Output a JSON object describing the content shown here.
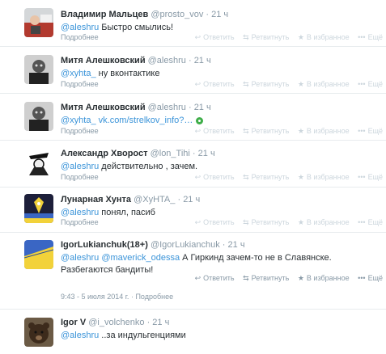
{
  "tweets": [
    {
      "fullname": "Владимир Мальцев",
      "username": "@prosto_vov",
      "time": "21 ч",
      "mention": "@aleshru",
      "text": " Быстро смылись!",
      "more": "Подробнее"
    },
    {
      "fullname": "Митя Алешковский",
      "username": "@aleshru",
      "time": "21 ч",
      "mention": "@xyhta_",
      "text": " ну вконтактике",
      "more": "Подробнее"
    },
    {
      "fullname": "Митя Алешковский",
      "username": "@aleshru",
      "time": "21 ч",
      "mention": "@xyhta_",
      "link": " vk.com/strelkov_info?…",
      "more": "Подробнее"
    },
    {
      "fullname": "Александр Хворост",
      "username": "@lon_Tihi",
      "time": "21 ч",
      "mention": "@aleshru",
      "text": " действительно , зачем.",
      "more": "Подробнее"
    },
    {
      "fullname": "Лунарная Хунта",
      "username": "@XyHTA_",
      "time": "21 ч",
      "mention": "@aleshru",
      "text": " понял, пасиб",
      "more": "Подробнее"
    },
    {
      "fullname": "IgorLukianchuk(18+)",
      "username": "@IgorLukianchuk",
      "time": "21 ч",
      "mention": "@aleshru",
      "mention2": "@maverick_odessa",
      "text": " А Гиркинд зачем-то не в Славянске.",
      "text2": "Разбегаются бандиты!",
      "timestamp": "9:43 - 5 июля 2014 г.",
      "separator": " · ",
      "more": "Подробнее"
    },
    {
      "fullname": "Igor V",
      "username": "@i_volchenko",
      "time": "21 ч",
      "mention": "@aleshru",
      "text": " ..за индульгенциями"
    }
  ],
  "actions": {
    "reply": "Ответить",
    "retweet": "Ретвитнуть",
    "favorite": "В избранное",
    "more": "Ещё"
  },
  "dot": "·",
  "icons": {
    "reply": "reply-icon",
    "retweet": "retweet-icon",
    "favorite": "star-icon",
    "more": "dots-icon",
    "external": "external-link-icon"
  },
  "colors": {
    "link": "#3b94d9",
    "secondary": "#8899a6",
    "border": "#e8ecee"
  }
}
